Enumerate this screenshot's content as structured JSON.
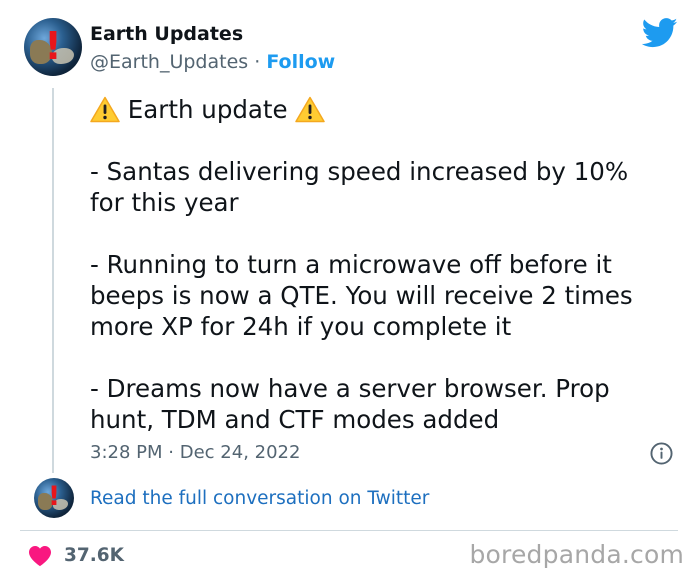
{
  "author": {
    "name": "Earth Updates",
    "handle": "@Earth_Updates",
    "separator": "·",
    "follow_label": "Follow"
  },
  "tweet": {
    "lines": [
      "Earth update",
      "",
      "- Santas delivering speed increased by 10%",
      "for this year",
      "",
      "- Running to turn a microwave off before it",
      "beeps is now a QTE. You will receive 2 times",
      "more XP for 24h if you complete it",
      "",
      "- Dreams now have a server browser. Prop",
      "hunt, TDM and CTF modes added"
    ],
    "time": "3:28 PM",
    "separator": "·",
    "date": "Dec 24, 2022"
  },
  "conversation": {
    "link_label": "Read the full conversation on Twitter"
  },
  "footer": {
    "likes": "37.6K",
    "watermark": "boredpanda.com"
  },
  "icons": {
    "logo": "twitter-bird-icon",
    "warning": "warning-icon",
    "info": "info-icon",
    "like": "heart-icon"
  },
  "colors": {
    "twitter_blue": "#1d9bf0",
    "link_blue": "#1d6fbf",
    "heart_pink": "#f91880",
    "text_primary": "#0f1419",
    "text_secondary": "#536471",
    "warning_yellow": "#ffcc32"
  }
}
